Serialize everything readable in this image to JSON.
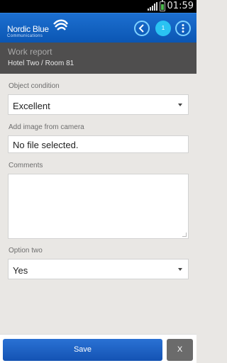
{
  "status_bar": {
    "time": "01:59"
  },
  "app": {
    "brand_name": "Nordic Blue",
    "brand_sub": "Communications",
    "notification_count": "1"
  },
  "header": {
    "title": "Work report",
    "subtitle": "Hotel Two / Room 81"
  },
  "form": {
    "object_condition": {
      "label": "Object condition",
      "value": "Excellent"
    },
    "image": {
      "label": "Add image from camera",
      "value": "No file selected."
    },
    "comments": {
      "label": "Comments",
      "value": ""
    },
    "option_two": {
      "label": "Option two",
      "value": "Yes"
    }
  },
  "footer": {
    "save_label": "Save",
    "close_label": "X"
  },
  "colors": {
    "accent": "#1c6fd0",
    "count_badge": "#2ac3f2",
    "subheader_bg": "#4f4e4e"
  }
}
